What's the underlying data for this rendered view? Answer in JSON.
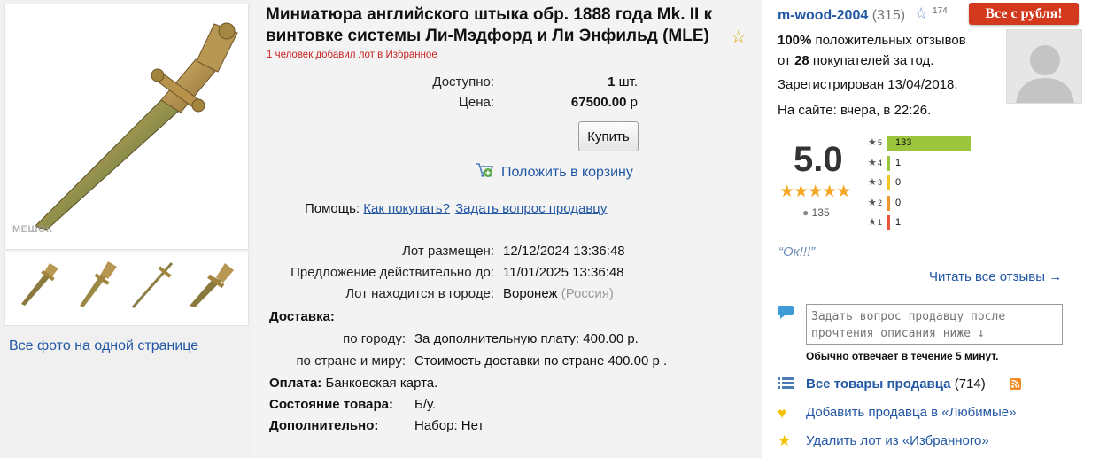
{
  "lot": {
    "title": "Миниатюра английского штыка обр. 1888 года Mk. II к винтовке системы Ли-Мэдфорд и Ли Энфильд (MLE)",
    "favorites_note": "1 человек добавил лот в Избранное",
    "available_label": "Доступно:",
    "available_value": "1",
    "available_unit": "шт.",
    "price_label": "Цена:",
    "price_value": "67500.00",
    "price_unit": "р",
    "buy_button": "Купить",
    "add_to_cart": "Положить в корзину",
    "help_label": "Помощь:",
    "help_how_to_buy": "Как покупать?",
    "help_ask_seller": "Задать вопрос продавцу",
    "placed_label": "Лот размещен:",
    "placed_value": "12/12/2024 13:36:48",
    "valid_label": "Предложение действительно до:",
    "valid_value": "11/01/2025 13:36:48",
    "city_label": "Лот находится в городе:",
    "city_value": "Воронеж",
    "country_value": "(Россия)",
    "delivery_label": "Доставка:",
    "delivery_city_label": "по городу:",
    "delivery_city_value": "За дополнительную плату: 400.00 р.",
    "delivery_world_label": "по стране и миру:",
    "delivery_world_value": "Стоимость доставки по стране 400.00 р .",
    "payment_label": "Оплата:",
    "payment_value": "Банковская карта.",
    "condition_label": "Состояние товара:",
    "condition_value": "Б/у.",
    "extra_label": "Дополнительно:",
    "extra_value": "Набор: Нет"
  },
  "gallery": {
    "watermark": "МЕШОК",
    "all_photos_link": "Все фото на одной странице",
    "thumb_count": 4
  },
  "seller": {
    "name": "m-wood-2004",
    "rating_count": "(315)",
    "star_count": "174",
    "all_from_ruble": "Все с рубля!",
    "positive_percent": "100%",
    "positive_text": "положительных отзывов",
    "buyers_prefix": "от",
    "buyers_count": "28",
    "buyers_suffix": "покупателей за год.",
    "registered": "Зарегистрирован 13/04/2018.",
    "online": "На сайте: вчера, в 22:26.",
    "score": "5.0",
    "reviews_total": "135",
    "review_quote": "“Ок!!!”",
    "read_all_reviews": "Читать все отзывы →",
    "ask_placeholder": "Задать вопрос продавцу после прочтения описания ниже ↓",
    "reply_time": "Обычно отвечает в течение 5 минут.",
    "all_items_label": "Все товары продавца",
    "all_items_count": "(714)",
    "add_favorite_seller": "Добавить продавца в «Любимые»",
    "remove_from_favorites": "Удалить лот из «Избранного»"
  },
  "rating_bars": [
    {
      "stars": "5",
      "count": "133",
      "fraction": 0.95,
      "color": "#9bc53d"
    },
    {
      "stars": "4",
      "count": "1",
      "fraction": 0.01,
      "color": "#9bc53d"
    },
    {
      "stars": "3",
      "count": "0",
      "fraction": 0,
      "color": "#f3c623"
    },
    {
      "stars": "2",
      "count": "0",
      "fraction": 0,
      "color": "#f0962e"
    },
    {
      "stars": "1",
      "count": "1",
      "fraction": 0.01,
      "color": "#e8553a"
    }
  ],
  "colors": {
    "link": "#2257a4",
    "accent_red": "#d2391d",
    "star_gold": "#f5a623"
  }
}
